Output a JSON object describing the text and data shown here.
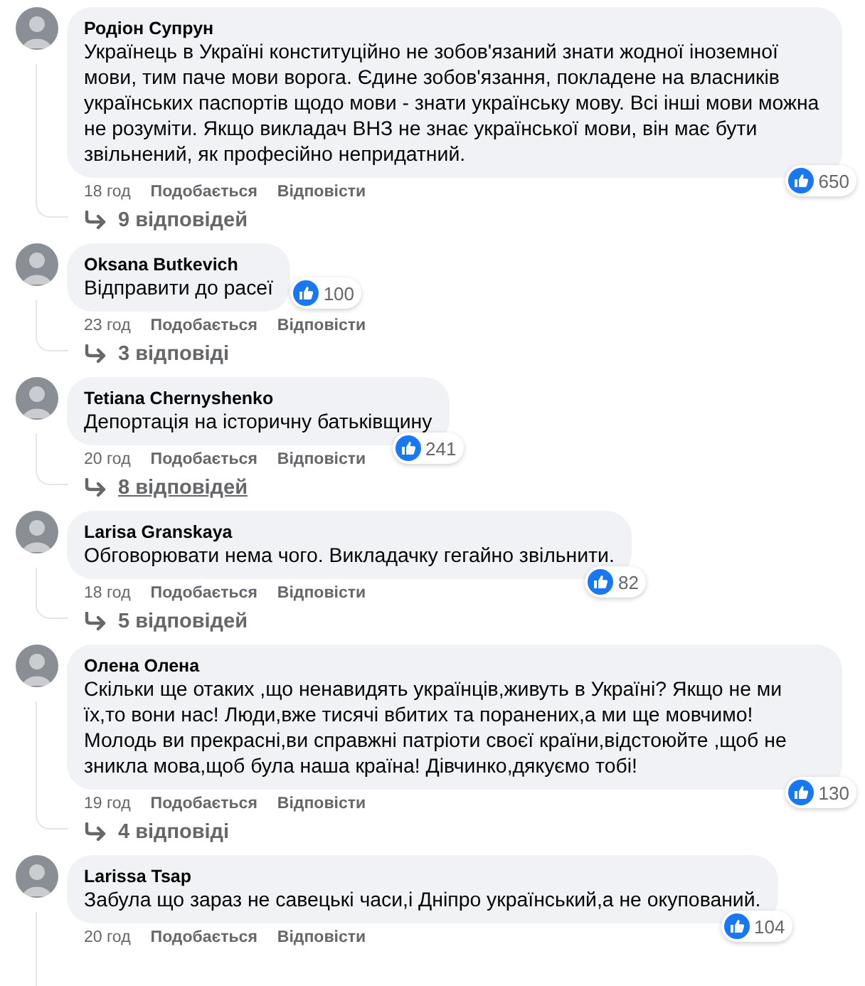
{
  "comments": [
    {
      "author": "Родіон Супрун",
      "kind": "long",
      "text": "Українець в Україні конституційно не зобов'язаний знати жодної іноземної мови, тим паче мови ворога. Єдине зобов'язання, покладене на власників українських паспортів щодо мови - знати українську мову. Всі інші мови можна не розуміти. Якщо викладач ВНЗ не знає української мови, він має бути звільнений, як професійно непридатний.",
      "likes": "650",
      "time": "18 год",
      "like_label": "Подобається",
      "reply_label": "Відповісти",
      "replies": "9 відповідей",
      "replies_hovered": false
    },
    {
      "author": "Oksana Butkevich",
      "kind": "short",
      "text": "Відправити до расеї",
      "likes": "100",
      "time": "23 год",
      "like_label": "Подобається",
      "reply_label": "Відповісти",
      "replies": "3 відповіді",
      "replies_hovered": false
    },
    {
      "author": "Tetiana Chernyshenko",
      "kind": "long",
      "text": "Депортація на історичну батьківщину",
      "likes": "241",
      "time": "20 год",
      "like_label": "Подобається",
      "reply_label": "Відповісти",
      "replies": "8 відповідей",
      "replies_hovered": true
    },
    {
      "author": "Larisa Granskaya",
      "kind": "long",
      "text": "Обговорювати нема чого. Викладачку гегайно звільнити.",
      "likes": "82",
      "time": "18 год",
      "like_label": "Подобається",
      "reply_label": "Відповісти",
      "replies": "5 відповідей",
      "replies_hovered": false
    },
    {
      "author": "Олена Олена",
      "kind": "long",
      "text": "Скільки ще отаких ,що ненавидять українців,живуть в Україні? Якщо не ми їх,то вони нас! Люди,вже тисячі вбитих та поранених,а ми ще мовчимо! Молодь ви прекрасні,ви справжні патріоти своєї країни,відстоюйте ,щоб не зникла мова,щоб була наша країна! Дівчинко,дякуємо тобі!",
      "likes": "130",
      "time": "19 год",
      "like_label": "Подобається",
      "reply_label": "Відповісти",
      "replies": "4 відповіді",
      "replies_hovered": false
    },
    {
      "author": "Larissa Tsap",
      "kind": "long",
      "text": "Забула що зараз не савецькі часи,і Дніпро український,а не окупований.",
      "likes": "104",
      "time": "20 год",
      "like_label": "Подобається",
      "reply_label": "Відповісти"
    }
  ]
}
